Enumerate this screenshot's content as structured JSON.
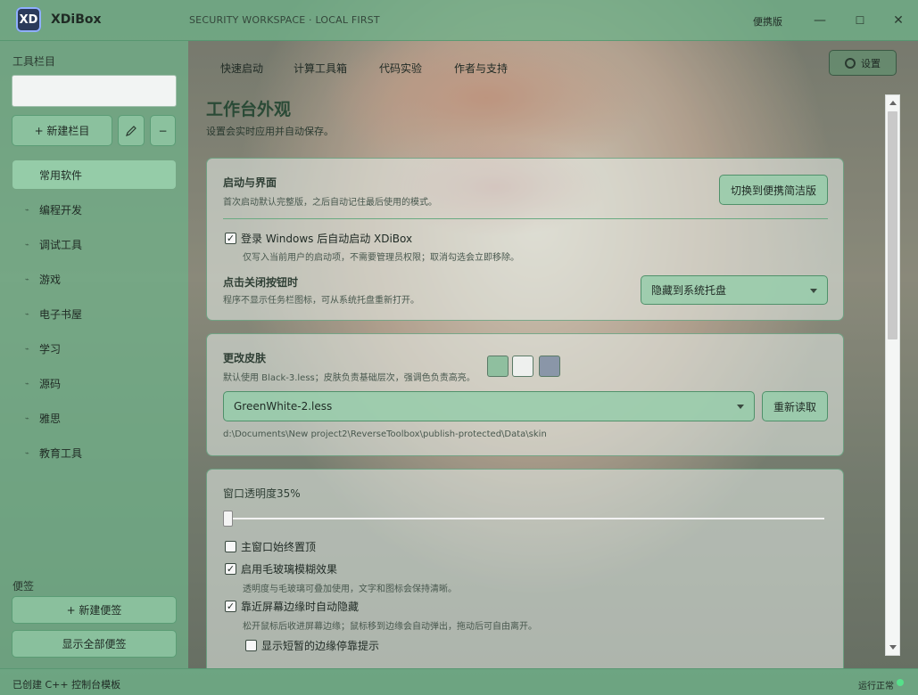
{
  "titlebar": {
    "logo": "XD",
    "app_name": "XDiBox",
    "subtitle": "SECURITY WORKSPACE · LOCAL FIRST",
    "portable": "便携版",
    "minimize": "—",
    "maximize": "☐",
    "close": "✕"
  },
  "sidebar": {
    "toolbar_label": "工具栏目",
    "search_value": "",
    "new_column": "+ 新建栏目",
    "edit_icon": "pencil-icon",
    "remove": "−",
    "items": [
      "常用软件",
      "编程开发",
      "调试工具",
      "游戏",
      "电子书屋",
      "学习",
      "源码",
      "雅思",
      "教育工具"
    ],
    "active_index": 0,
    "notes_label": "便签",
    "new_note": "+ 新建便签",
    "show_notes": "显示全部便签"
  },
  "topnav": {
    "tabs": [
      "快速启动",
      "计算工具箱",
      "代码实验",
      "作者与支持"
    ],
    "settings": "设置"
  },
  "page": {
    "title": "工作台外观",
    "subtitle": "设置会实时应用并自动保存。"
  },
  "startup_card": {
    "title": "启动与界面",
    "desc": "首次启动默认完整版，之后自动记住最后使用的模式。",
    "switch_button": "切换到便携简洁版",
    "autostart_label": "登录 Windows 后自动启动 XDiBox",
    "autostart_checked": true,
    "autostart_desc": "仅写入当前用户的启动项，不需要管理员权限；取消勾选会立即移除。",
    "close_title": "点击关闭按钮时",
    "close_desc": "程序不显示任务栏图标，可从系统托盘重新打开。",
    "close_option": "隐藏到系统托盘"
  },
  "skin_card": {
    "title": "更改皮肤",
    "desc": "默认使用 Black-3.less；皮肤负责基础层次，强调色负责高亮。",
    "swatch_colors": [
      "#8fbf9f",
      "#eef0ee",
      "#8a96a8"
    ],
    "skin_file": "GreenWhite-2.less",
    "reload_button": "重新读取",
    "path": "d:\\Documents\\New project2\\ReverseToolbox\\publish-protected\\Data\\skin"
  },
  "window_card": {
    "opacity_label": "窗口透明度",
    "opacity_value": "35%",
    "opacity_fraction": 0.0,
    "always_on_top": "主窗口始终置顶",
    "always_on_top_checked": false,
    "blur_label": "启用毛玻璃模糊效果",
    "blur_checked": true,
    "blur_desc": "透明度与毛玻璃可叠加使用，文字和图标会保持清晰。",
    "edge_hide_label": "靠近屏幕边缘时自动隐藏",
    "edge_hide_checked": true,
    "edge_hide_desc": "松开鼠标后收进屏幕边缘；鼠标移到边缘会自动弹出，拖动后可自由离开。",
    "edge_hint_label": "显示短暂的边缘停靠提示",
    "edge_hint_checked": false
  },
  "statusbar": {
    "left": "已创建 C++ 控制台模板",
    "right": "运行正常",
    "status_color": "#56e08a"
  }
}
